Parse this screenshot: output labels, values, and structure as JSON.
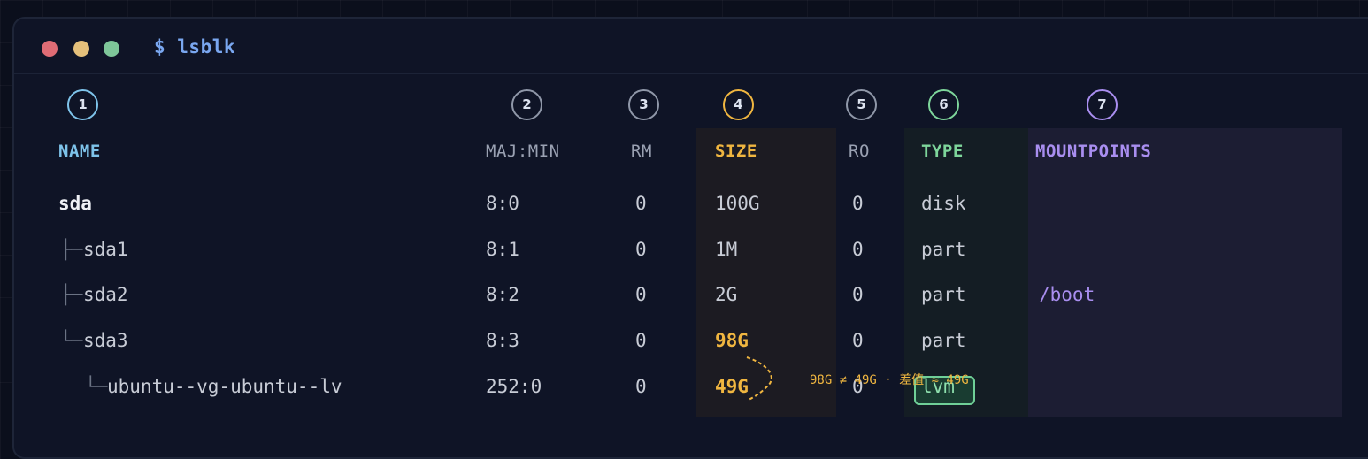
{
  "window": {
    "prompt": "$ lsblk"
  },
  "columns": [
    {
      "id": "name",
      "badge": "1",
      "label": "NAME",
      "color": "#7ec3ea"
    },
    {
      "id": "majmin",
      "badge": "2",
      "label": "MAJ:MIN",
      "color": "#9aa1b2"
    },
    {
      "id": "rm",
      "badge": "3",
      "label": "RM",
      "color": "#9aa1b2"
    },
    {
      "id": "size",
      "badge": "4",
      "label": "SIZE",
      "color": "#f0b640"
    },
    {
      "id": "ro",
      "badge": "5",
      "label": "RO",
      "color": "#9aa1b2"
    },
    {
      "id": "type",
      "badge": "6",
      "label": "TYPE",
      "color": "#7ed69b"
    },
    {
      "id": "mountpoints",
      "badge": "7",
      "label": "MOUNTPOINTS",
      "color": "#a98ef0"
    }
  ],
  "rows": [
    {
      "tree": "",
      "name": "sda",
      "majmin": "8:0",
      "rm": "0",
      "size": "100G",
      "ro": "0",
      "type": "disk",
      "mountpoints": ""
    },
    {
      "tree": "├─",
      "name": "sda1",
      "majmin": "8:1",
      "rm": "0",
      "size": "1M",
      "ro": "0",
      "type": "part",
      "mountpoints": ""
    },
    {
      "tree": "├─",
      "name": "sda2",
      "majmin": "8:2",
      "rm": "0",
      "size": "2G",
      "ro": "0",
      "type": "part",
      "mountpoints": "/boot"
    },
    {
      "tree": "└─",
      "name": "sda3",
      "majmin": "8:3",
      "rm": "0",
      "size": "98G",
      "ro": "0",
      "type": "part",
      "mountpoints": ""
    },
    {
      "tree": "└─",
      "name": "ubuntu--vg-ubuntu--lv",
      "majmin": "252:0",
      "rm": "0",
      "size": "49G",
      "ro": "0",
      "type": "lvm",
      "mountpoints": ""
    }
  ],
  "annotation": {
    "text": "98G ≠ 49G · 差值 ≈ 49G",
    "color": "#f0b640"
  },
  "colors": {
    "size_highlight": "#f0b640",
    "mount": "#a98ef0",
    "lvm_border": "#6fcf97"
  }
}
